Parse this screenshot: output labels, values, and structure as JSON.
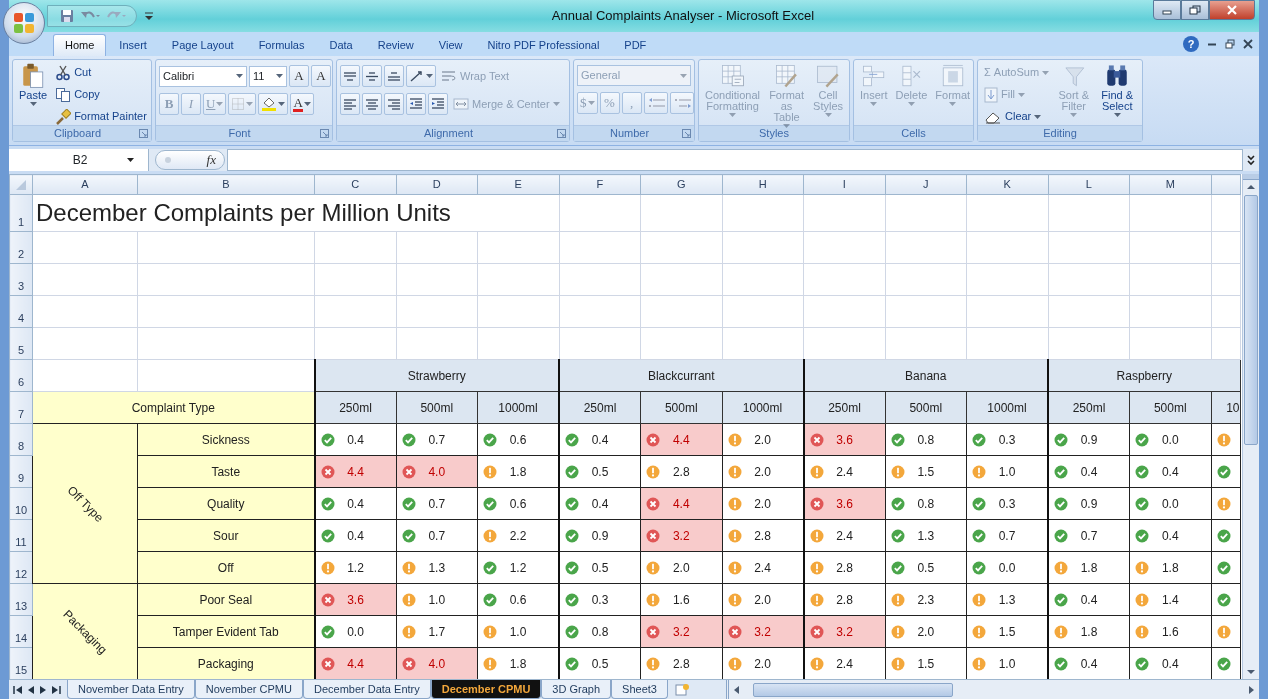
{
  "window": {
    "title": "Annual Complaints Analyser - Microsoft Excel"
  },
  "ribbon_tabs": [
    {
      "label": "Home",
      "selected": true
    },
    {
      "label": "Insert",
      "selected": false
    },
    {
      "label": "Page Layout",
      "selected": false
    },
    {
      "label": "Formulas",
      "selected": false
    },
    {
      "label": "Data",
      "selected": false
    },
    {
      "label": "Review",
      "selected": false
    },
    {
      "label": "View",
      "selected": false
    },
    {
      "label": "Nitro PDF Professional",
      "selected": false
    },
    {
      "label": "PDF",
      "selected": false
    }
  ],
  "help_button": {
    "glyph": "?"
  },
  "ribbon_groups": [
    {
      "label": "Clipboard",
      "launcher": true,
      "blocks": [
        {
          "kind": "large",
          "items": [
            {
              "kind": "button",
              "label": "Paste",
              "dropdown": true,
              "disabled": false
            }
          ]
        },
        {
          "kind": "stack",
          "items": [
            {
              "kind": "button",
              "label": "Cut",
              "disabled": false
            },
            {
              "kind": "button",
              "label": "Copy",
              "disabled": false
            },
            {
              "kind": "button",
              "label": "Format Painter",
              "disabled": false
            }
          ]
        }
      ]
    },
    {
      "label": "Font",
      "launcher": true,
      "blocks": [
        {
          "kind": "rows",
          "rows": [
            {
              "items": [
                {
                  "kind": "field",
                  "value": "Calibri",
                  "dropdown": true,
                  "disabled": false
                },
                {
                  "kind": "field",
                  "value": "11",
                  "dropdown": true,
                  "disabled": false
                },
                {
                  "kind": "button",
                  "glyph": "A",
                  "disabled": false
                },
                {
                  "kind": "button",
                  "glyph": "A",
                  "disabled": false
                }
              ]
            },
            {
              "items": [
                {
                  "kind": "button",
                  "glyph": "B",
                  "disabled": true
                },
                {
                  "kind": "button",
                  "glyph": "I",
                  "disabled": true
                },
                {
                  "kind": "button",
                  "glyph": "U",
                  "dropdown": true,
                  "disabled": true
                },
                {
                  "kind": "button",
                  "dropdown": true,
                  "disabled": true
                },
                {
                  "kind": "button",
                  "dropdown": true,
                  "disabled": false
                },
                {
                  "kind": "button",
                  "glyph": "A",
                  "dropdown": true,
                  "disabled": false
                }
              ]
            }
          ]
        }
      ]
    },
    {
      "label": "Alignment",
      "launcher": true,
      "blocks": [
        {
          "kind": "rows",
          "rows": [
            {
              "items": [
                {
                  "kind": "button",
                  "disabled": false
                },
                {
                  "kind": "button",
                  "disabled": false
                },
                {
                  "kind": "button",
                  "disabled": false
                },
                {
                  "kind": "button",
                  "dropdown": true,
                  "disabled": false
                },
                {
                  "kind": "button",
                  "label": "Wrap Text",
                  "disabled": true
                }
              ]
            },
            {
              "items": [
                {
                  "kind": "button",
                  "disabled": false
                },
                {
                  "kind": "button",
                  "disabled": false
                },
                {
                  "kind": "button",
                  "disabled": false
                },
                {
                  "kind": "button",
                  "disabled": false
                },
                {
                  "kind": "button",
                  "disabled": false
                },
                {
                  "kind": "button",
                  "label": "Merge & Center",
                  "dropdown": true,
                  "disabled": true
                }
              ]
            }
          ]
        }
      ]
    },
    {
      "label": "Number",
      "launcher": true,
      "blocks": [
        {
          "kind": "rows",
          "rows": [
            {
              "items": [
                {
                  "kind": "field",
                  "value": "General",
                  "dropdown": true,
                  "disabled": true
                }
              ]
            },
            {
              "items": [
                {
                  "kind": "button",
                  "glyph": "$",
                  "dropdown": true,
                  "disabled": true
                },
                {
                  "kind": "button",
                  "glyph": "%",
                  "disabled": true
                },
                {
                  "kind": "button",
                  "glyph": ",",
                  "disabled": true
                },
                {
                  "kind": "button",
                  "disabled": true
                },
                {
                  "kind": "button",
                  "disabled": true
                }
              ]
            }
          ]
        }
      ]
    },
    {
      "label": "Styles",
      "launcher": false,
      "blocks": [
        {
          "kind": "large",
          "items": [
            {
              "kind": "button",
              "label": "Conditional Formatting",
              "dropdown": true,
              "disabled": true
            },
            {
              "kind": "button",
              "label": "Format as Table",
              "dropdown": true,
              "disabled": true
            },
            {
              "kind": "button",
              "label": "Cell Styles",
              "dropdown": true,
              "disabled": true
            }
          ]
        }
      ]
    },
    {
      "label": "Cells",
      "launcher": false,
      "blocks": [
        {
          "kind": "large",
          "items": [
            {
              "kind": "button",
              "label": "Insert",
              "dropdown": true,
              "disabled": true
            },
            {
              "kind": "button",
              "label": "Delete",
              "dropdown": true,
              "disabled": true
            },
            {
              "kind": "button",
              "label": "Format",
              "dropdown": true,
              "disabled": true
            }
          ]
        }
      ]
    },
    {
      "label": "Editing",
      "launcher": false,
      "blocks": [
        {
          "kind": "stack",
          "items": [
            {
              "kind": "button",
              "glyph": "Σ",
              "label": "AutoSum",
              "dropdown": true,
              "disabled": true
            },
            {
              "kind": "button",
              "label": "Fill",
              "dropdown": true,
              "disabled": true
            },
            {
              "kind": "button",
              "label": "Clear",
              "dropdown": true,
              "disabled": false
            }
          ]
        },
        {
          "kind": "large",
          "items": [
            {
              "kind": "button",
              "label": "Sort & Filter",
              "dropdown": true,
              "disabled": true
            },
            {
              "kind": "button",
              "label": "Find & Select",
              "dropdown": true,
              "disabled": false
            }
          ]
        }
      ]
    }
  ],
  "formula_bar": {
    "name_box": "B2",
    "function_label": "fx"
  },
  "sheet": {
    "column_headers": [
      "A",
      "B",
      "C",
      "D",
      "E",
      "F",
      "G",
      "H",
      "I",
      "J",
      "K",
      "L",
      "M"
    ],
    "row_headers": [
      "1",
      "2",
      "3",
      "4",
      "5",
      "6",
      "7",
      "8",
      "9",
      "10",
      "11",
      "12",
      "13",
      "14",
      "15"
    ],
    "title": "December Complaints per Million Units",
    "type_header": "Complaint Type",
    "products": [
      {
        "name": "Strawberry",
        "sizes": [
          "250ml",
          "500ml",
          "1000ml"
        ]
      },
      {
        "name": "Blackcurrant",
        "sizes": [
          "250ml",
          "500ml",
          "1000ml"
        ]
      },
      {
        "name": "Banana",
        "sizes": [
          "250ml",
          "500ml",
          "1000ml"
        ]
      },
      {
        "name": "Raspberry",
        "sizes": [
          "250ml",
          "500ml",
          "10"
        ]
      }
    ],
    "groups": [
      {
        "name": "Off Type",
        "rows": [
          {
            "label": "Sickness",
            "cells": [
              {
                "kind": "ok",
                "value": "0.4"
              },
              {
                "kind": "ok",
                "value": "0.7"
              },
              {
                "kind": "ok",
                "value": "0.6"
              },
              {
                "kind": "ok",
                "value": "0.4"
              },
              {
                "kind": "bad",
                "value": "4.4"
              },
              {
                "kind": "warn",
                "value": "2.0"
              },
              {
                "kind": "bad",
                "value": "3.6"
              },
              {
                "kind": "ok",
                "value": "0.8"
              },
              {
                "kind": "ok",
                "value": "0.3"
              },
              {
                "kind": "ok",
                "value": "0.9"
              },
              {
                "kind": "ok",
                "value": "0.0"
              },
              {
                "kind": "warn"
              }
            ]
          },
          {
            "label": "Taste",
            "cells": [
              {
                "kind": "bad",
                "value": "4.4"
              },
              {
                "kind": "bad",
                "value": "4.0"
              },
              {
                "kind": "warn",
                "value": "1.8"
              },
              {
                "kind": "ok",
                "value": "0.5"
              },
              {
                "kind": "warn",
                "value": "2.8"
              },
              {
                "kind": "warn",
                "value": "2.0"
              },
              {
                "kind": "warn",
                "value": "2.4"
              },
              {
                "kind": "warn",
                "value": "1.5"
              },
              {
                "kind": "warn",
                "value": "1.0"
              },
              {
                "kind": "ok",
                "value": "0.4"
              },
              {
                "kind": "ok",
                "value": "0.4"
              },
              {
                "kind": "ok"
              }
            ]
          },
          {
            "label": "Quality",
            "cells": [
              {
                "kind": "ok",
                "value": "0.4"
              },
              {
                "kind": "ok",
                "value": "0.7"
              },
              {
                "kind": "ok",
                "value": "0.6"
              },
              {
                "kind": "ok",
                "value": "0.4"
              },
              {
                "kind": "bad",
                "value": "4.4"
              },
              {
                "kind": "warn",
                "value": "2.0"
              },
              {
                "kind": "bad",
                "value": "3.6"
              },
              {
                "kind": "ok",
                "value": "0.8"
              },
              {
                "kind": "ok",
                "value": "0.3"
              },
              {
                "kind": "ok",
                "value": "0.9"
              },
              {
                "kind": "ok",
                "value": "0.0"
              },
              {
                "kind": "warn"
              }
            ]
          },
          {
            "label": "Sour",
            "cells": [
              {
                "kind": "ok",
                "value": "0.4"
              },
              {
                "kind": "ok",
                "value": "0.7"
              },
              {
                "kind": "warn",
                "value": "2.2"
              },
              {
                "kind": "ok",
                "value": "0.9"
              },
              {
                "kind": "bad",
                "value": "3.2"
              },
              {
                "kind": "warn",
                "value": "2.8"
              },
              {
                "kind": "warn",
                "value": "2.4"
              },
              {
                "kind": "ok",
                "value": "1.3"
              },
              {
                "kind": "ok",
                "value": "0.7"
              },
              {
                "kind": "ok",
                "value": "0.7"
              },
              {
                "kind": "ok",
                "value": "0.4"
              },
              {
                "kind": "ok"
              }
            ]
          },
          {
            "label": "Off",
            "cells": [
              {
                "kind": "warn",
                "value": "1.2"
              },
              {
                "kind": "warn",
                "value": "1.3"
              },
              {
                "kind": "ok",
                "value": "1.2"
              },
              {
                "kind": "ok",
                "value": "0.5"
              },
              {
                "kind": "warn",
                "value": "2.0"
              },
              {
                "kind": "warn",
                "value": "2.4"
              },
              {
                "kind": "warn",
                "value": "2.8"
              },
              {
                "kind": "ok",
                "value": "0.5"
              },
              {
                "kind": "ok",
                "value": "0.0"
              },
              {
                "kind": "warn",
                "value": "1.8"
              },
              {
                "kind": "warn",
                "value": "1.8"
              },
              {
                "kind": "ok"
              }
            ]
          }
        ]
      },
      {
        "name": "Packaging",
        "rows": [
          {
            "label": "Poor Seal",
            "cells": [
              {
                "kind": "bad",
                "value": "3.6"
              },
              {
                "kind": "warn",
                "value": "1.0"
              },
              {
                "kind": "ok",
                "value": "0.6"
              },
              {
                "kind": "ok",
                "value": "0.3"
              },
              {
                "kind": "warn",
                "value": "1.6"
              },
              {
                "kind": "warn",
                "value": "2.0"
              },
              {
                "kind": "warn",
                "value": "2.8"
              },
              {
                "kind": "warn",
                "value": "2.3"
              },
              {
                "kind": "warn",
                "value": "1.3"
              },
              {
                "kind": "ok",
                "value": "0.4"
              },
              {
                "kind": "warn",
                "value": "1.4"
              },
              {
                "kind": "ok"
              }
            ]
          },
          {
            "label": "Tamper Evident Tab",
            "cells": [
              {
                "kind": "ok",
                "value": "0.0"
              },
              {
                "kind": "warn",
                "value": "1.7"
              },
              {
                "kind": "warn",
                "value": "1.0"
              },
              {
                "kind": "ok",
                "value": "0.8"
              },
              {
                "kind": "bad",
                "value": "3.2"
              },
              {
                "kind": "bad",
                "value": "3.2"
              },
              {
                "kind": "bad",
                "value": "3.2"
              },
              {
                "kind": "warn",
                "value": "2.0"
              },
              {
                "kind": "warn",
                "value": "1.5"
              },
              {
                "kind": "warn",
                "value": "1.8"
              },
              {
                "kind": "warn",
                "value": "1.6"
              },
              {
                "kind": "warn"
              }
            ]
          },
          {
            "label": "Packaging",
            "cells": [
              {
                "kind": "bad",
                "value": "4.4"
              },
              {
                "kind": "bad",
                "value": "4.0"
              },
              {
                "kind": "warn",
                "value": "1.8"
              },
              {
                "kind": "ok",
                "value": "0.5"
              },
              {
                "kind": "warn",
                "value": "2.8"
              },
              {
                "kind": "warn",
                "value": "2.0"
              },
              {
                "kind": "warn",
                "value": "2.4"
              },
              {
                "kind": "warn",
                "value": "1.5"
              },
              {
                "kind": "warn",
                "value": "1.0"
              },
              {
                "kind": "ok",
                "value": "0.4"
              },
              {
                "kind": "ok",
                "value": "0.4"
              },
              {
                "kind": "ok"
              }
            ]
          }
        ]
      }
    ]
  },
  "sheet_tabs": [
    {
      "label": "November Data Entry",
      "selected": false
    },
    {
      "label": "November CPMU",
      "selected": false
    },
    {
      "label": "December Data Entry",
      "selected": false
    },
    {
      "label": "December CPMU",
      "selected": true
    },
    {
      "label": "3D Graph",
      "selected": false
    },
    {
      "label": "Sheet3",
      "selected": false
    }
  ]
}
